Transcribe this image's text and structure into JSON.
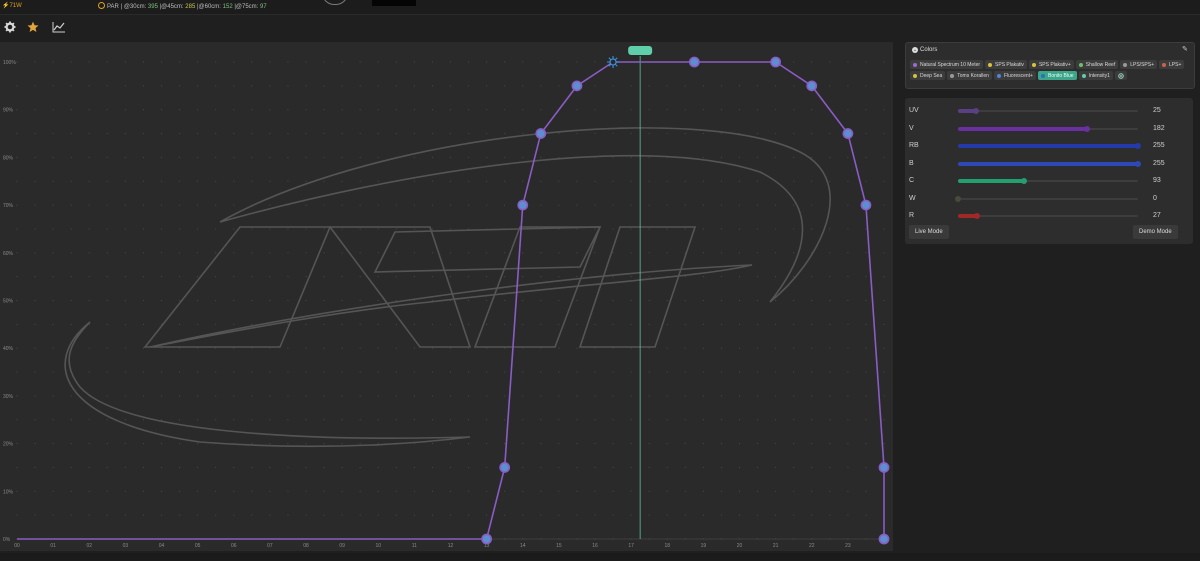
{
  "topbar": {
    "power": "⚡71W",
    "par_label": "PAR",
    "par_30": "@30cm:",
    "par_30_val": "395",
    "par_45": "@45cm:",
    "par_45_val": "285",
    "par_60": "@60cm:",
    "par_60_val": "152",
    "par_75": "@75cm:",
    "par_75_val": "97"
  },
  "toolbar": {
    "icons": [
      "gear-icon",
      "star-icon",
      "chart-line-icon"
    ]
  },
  "chart_data": {
    "type": "line",
    "x_ticks": [
      "00",
      "01",
      "02",
      "03",
      "04",
      "05",
      "06",
      "07",
      "08",
      "09",
      "10",
      "11",
      "12",
      "13",
      "14",
      "15",
      "16",
      "17",
      "18",
      "19",
      "20",
      "21",
      "22",
      "23"
    ],
    "y_ticks": [
      "0%",
      "10%",
      "20%",
      "30%",
      "40%",
      "50%",
      "60%",
      "70%",
      "80%",
      "90%",
      "100%"
    ],
    "xlim": [
      0,
      24
    ],
    "ylim": [
      0,
      100
    ],
    "grid": true,
    "series": [
      {
        "color": "#8a5cc5",
        "points": [
          [
            0,
            0
          ],
          [
            13.0,
            0
          ],
          [
            13.5,
            15
          ],
          [
            14.0,
            70
          ],
          [
            14.5,
            85
          ],
          [
            15.5,
            95
          ],
          [
            16.5,
            100
          ],
          [
            18.75,
            100
          ],
          [
            21.0,
            100
          ],
          [
            22.0,
            95
          ],
          [
            23.0,
            85
          ],
          [
            23.5,
            70
          ],
          [
            24.0,
            15
          ],
          [
            24.0,
            0
          ]
        ]
      }
    ],
    "current_time": 17.25,
    "highlight_point_index": 6,
    "watermark": "ATI",
    "accent": "#5ecfa8"
  },
  "colors_panel": {
    "title": "Colors",
    "chips": [
      {
        "label": "Natural Spectrum 10 Meter",
        "color": "#9b6bd1"
      },
      {
        "label": "SPS Plakativ",
        "color": "#d8c23a"
      },
      {
        "label": "SPS Plakativ+",
        "color": "#d8c23a"
      },
      {
        "label": "Shallow Reef",
        "color": "#6cc06c"
      },
      {
        "label": "LPS/SPS+",
        "color": "#9a9a9a"
      },
      {
        "label": "LPS+",
        "color": "#d0604a"
      },
      {
        "label": "Deep Sea",
        "color": "#d8c23a"
      },
      {
        "label": "Toms Korallen",
        "color": "#9a9a9a"
      },
      {
        "label": "Fluorescent+",
        "color": "#4d86d8"
      },
      {
        "label": "Bonito Blue",
        "color": "#2d6fbf",
        "active": true
      },
      {
        "label": "Intensity1",
        "color": "#5ecfa8"
      }
    ]
  },
  "channels": [
    {
      "label": "UV",
      "value": "25",
      "level": 0.098,
      "color": "#5a3f84"
    },
    {
      "label": "V",
      "value": "182",
      "level": 0.714,
      "color": "#6a2fa0"
    },
    {
      "label": "RB",
      "value": "255",
      "level": 1.0,
      "color": "#243aa8"
    },
    {
      "label": "B",
      "value": "255",
      "level": 1.0,
      "color": "#2f48b8"
    },
    {
      "label": "C",
      "value": "93",
      "level": 0.365,
      "color": "#22a070"
    },
    {
      "label": "W",
      "value": "0",
      "level": 0.0,
      "color": "#6b6b6b"
    },
    {
      "label": "R",
      "value": "27",
      "level": 0.106,
      "color": "#a02828"
    }
  ],
  "buttons": {
    "live_mode": "Live Mode",
    "demo_mode": "Demo Mode"
  }
}
